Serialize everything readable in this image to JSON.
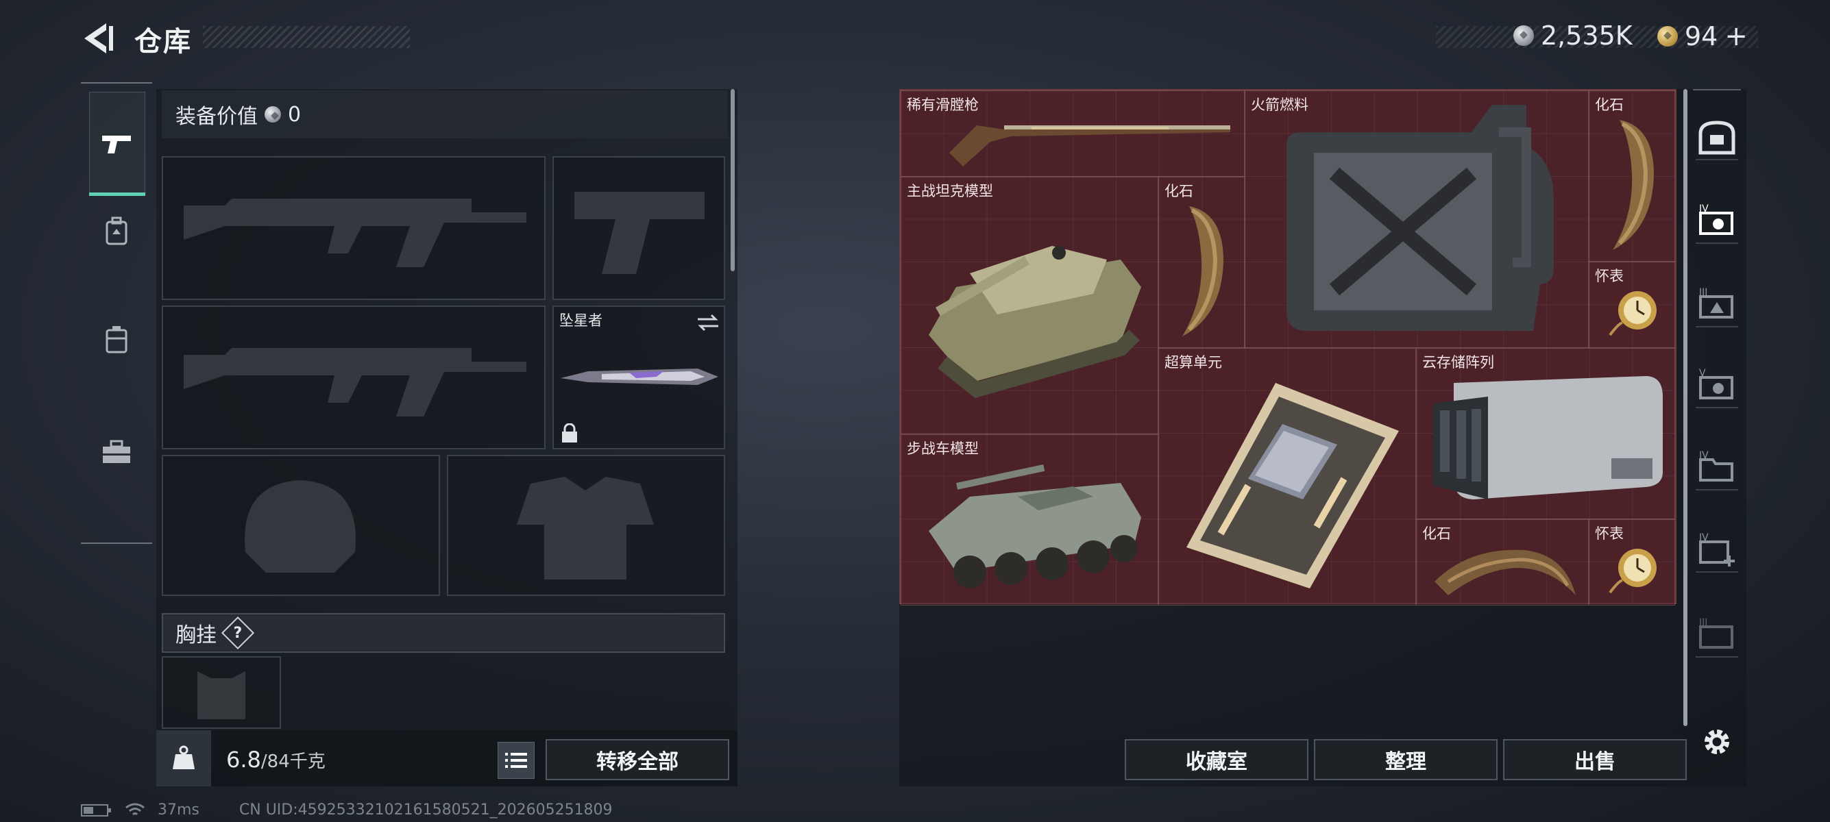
{
  "header": {
    "title": "仓库"
  },
  "currency": {
    "silver": "2,535K",
    "gold": "94",
    "gold_add": "+"
  },
  "loadout": {
    "equip_value_label": "装备价值",
    "equip_value": "0",
    "slot_melee_name": "坠星者",
    "chest_label": "胸挂",
    "chest_help": "?",
    "weight_current": "6.8",
    "weight_max": "/84千克",
    "transfer_all": "转移全部"
  },
  "storage": {
    "items": [
      {
        "label": "稀有滑膛枪",
        "icon": "musket"
      },
      {
        "label": "火箭燃料",
        "icon": "fuel-canister"
      },
      {
        "label": "化石",
        "icon": "fossil-claw"
      },
      {
        "label": "主战坦克模型",
        "icon": "tank-model"
      },
      {
        "label": "化石",
        "icon": "fossil-claw"
      },
      {
        "label": "怀表",
        "icon": "pocket-watch"
      },
      {
        "label": "超算单元",
        "icon": "compute-unit"
      },
      {
        "label": "云存储阵列",
        "icon": "storage-array"
      },
      {
        "label": "步战车模型",
        "icon": "ifv-model"
      },
      {
        "label": "化石",
        "icon": "fossil-claw"
      },
      {
        "label": "怀表",
        "icon": "pocket-watch"
      }
    ],
    "buttons": {
      "collection": "收藏室",
      "organize": "整理",
      "sell": "出售"
    }
  },
  "status": {
    "ping": "37ms",
    "uid": "CN UID:45925332102161580521_202605251809"
  },
  "colors": {
    "accent": "#5fd1b0",
    "storage_bg": "#4a2428"
  }
}
